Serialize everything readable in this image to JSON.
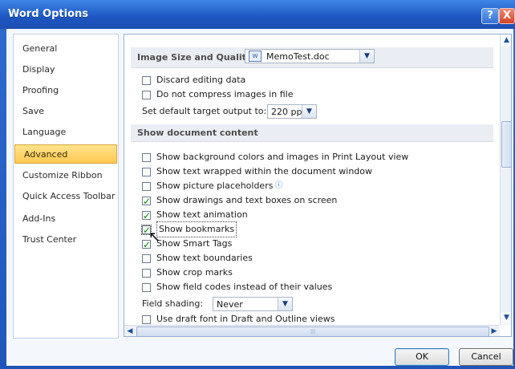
{
  "window": {
    "title": "Word Options",
    "help_label": "?",
    "close_label": "X"
  },
  "nav": {
    "items": [
      {
        "label": "General"
      },
      {
        "label": "Display"
      },
      {
        "label": "Proofing"
      },
      {
        "label": "Save"
      },
      {
        "label": "Language"
      },
      {
        "label": "Advanced",
        "selected": true
      },
      {
        "label": "Customize Ribbon"
      },
      {
        "label": "Quick Access Toolbar"
      },
      {
        "label": "Add-Ins"
      },
      {
        "label": "Trust Center"
      }
    ]
  },
  "image_section": {
    "title": "Image Size and Quality",
    "doc_select": "MemoTest.doc",
    "discard_editing": {
      "label": "Discard editing data",
      "checked": false
    },
    "no_compress": {
      "label": "Do not compress images in file",
      "checked": false
    },
    "target_output_label": "Set default target output to:",
    "target_output_value": "220 ppi"
  },
  "doc_content": {
    "title": "Show document content",
    "options": [
      {
        "label": "Show background colors and images in Print Layout view",
        "checked": false
      },
      {
        "label": "Show text wrapped within the document window",
        "checked": false
      },
      {
        "label": "Show picture placeholders",
        "checked": false
      },
      {
        "label": "Show drawings and text boxes on screen",
        "checked": true
      },
      {
        "label": "Show text animation",
        "checked": true
      },
      {
        "label": "Show bookmarks",
        "checked": true
      },
      {
        "label": "Show Smart Tags",
        "checked": true
      },
      {
        "label": "Show text boundaries",
        "checked": false
      },
      {
        "label": "Show crop marks",
        "checked": false
      },
      {
        "label": "Show field codes instead of their values",
        "checked": false
      }
    ],
    "field_shading_label": "Field shading:",
    "field_shading_value": "Never",
    "draft_font": {
      "label": "Use draft font in Draft and Outline views",
      "checked": false
    }
  },
  "footer": {
    "ok": "OK",
    "cancel": "Cancel"
  },
  "colors": {
    "title_bar": "#1d56c0",
    "selected_nav": "#ffc953"
  },
  "icons": {
    "info": "info-icon",
    "cursor": "mouse-pointer-icon"
  }
}
